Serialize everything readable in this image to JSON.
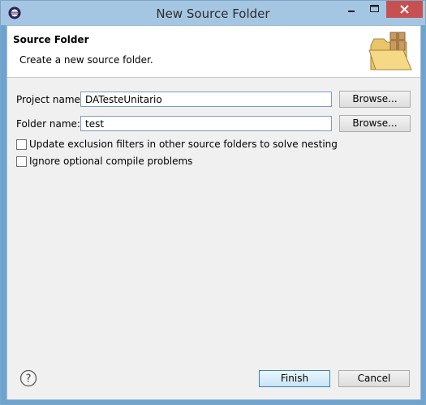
{
  "window": {
    "title": "New Source Folder"
  },
  "header": {
    "title": "Source Folder",
    "description": "Create a new source folder."
  },
  "form": {
    "project_label": "Project name:",
    "project_value": "DATesteUnitario",
    "folder_label": "Folder name:",
    "folder_value": "test",
    "browse_label": "Browse..."
  },
  "options": {
    "update_exclusion": {
      "label": "Update exclusion filters in other source folders to solve nesting",
      "checked": false
    },
    "ignore_optional": {
      "label": "Ignore optional compile problems",
      "checked": false
    }
  },
  "footer": {
    "finish_label": "Finish",
    "cancel_label": "Cancel"
  },
  "icons": {
    "app": "eclipse-icon",
    "minimize": "minimize-icon",
    "maximize": "maximize-icon",
    "close": "close-icon",
    "wizard": "package-folder-icon",
    "help": "help-icon"
  },
  "colors": {
    "titlebar": "#a5c6e2",
    "close_button": "#c75050",
    "field_border": "#7a9cc6"
  }
}
